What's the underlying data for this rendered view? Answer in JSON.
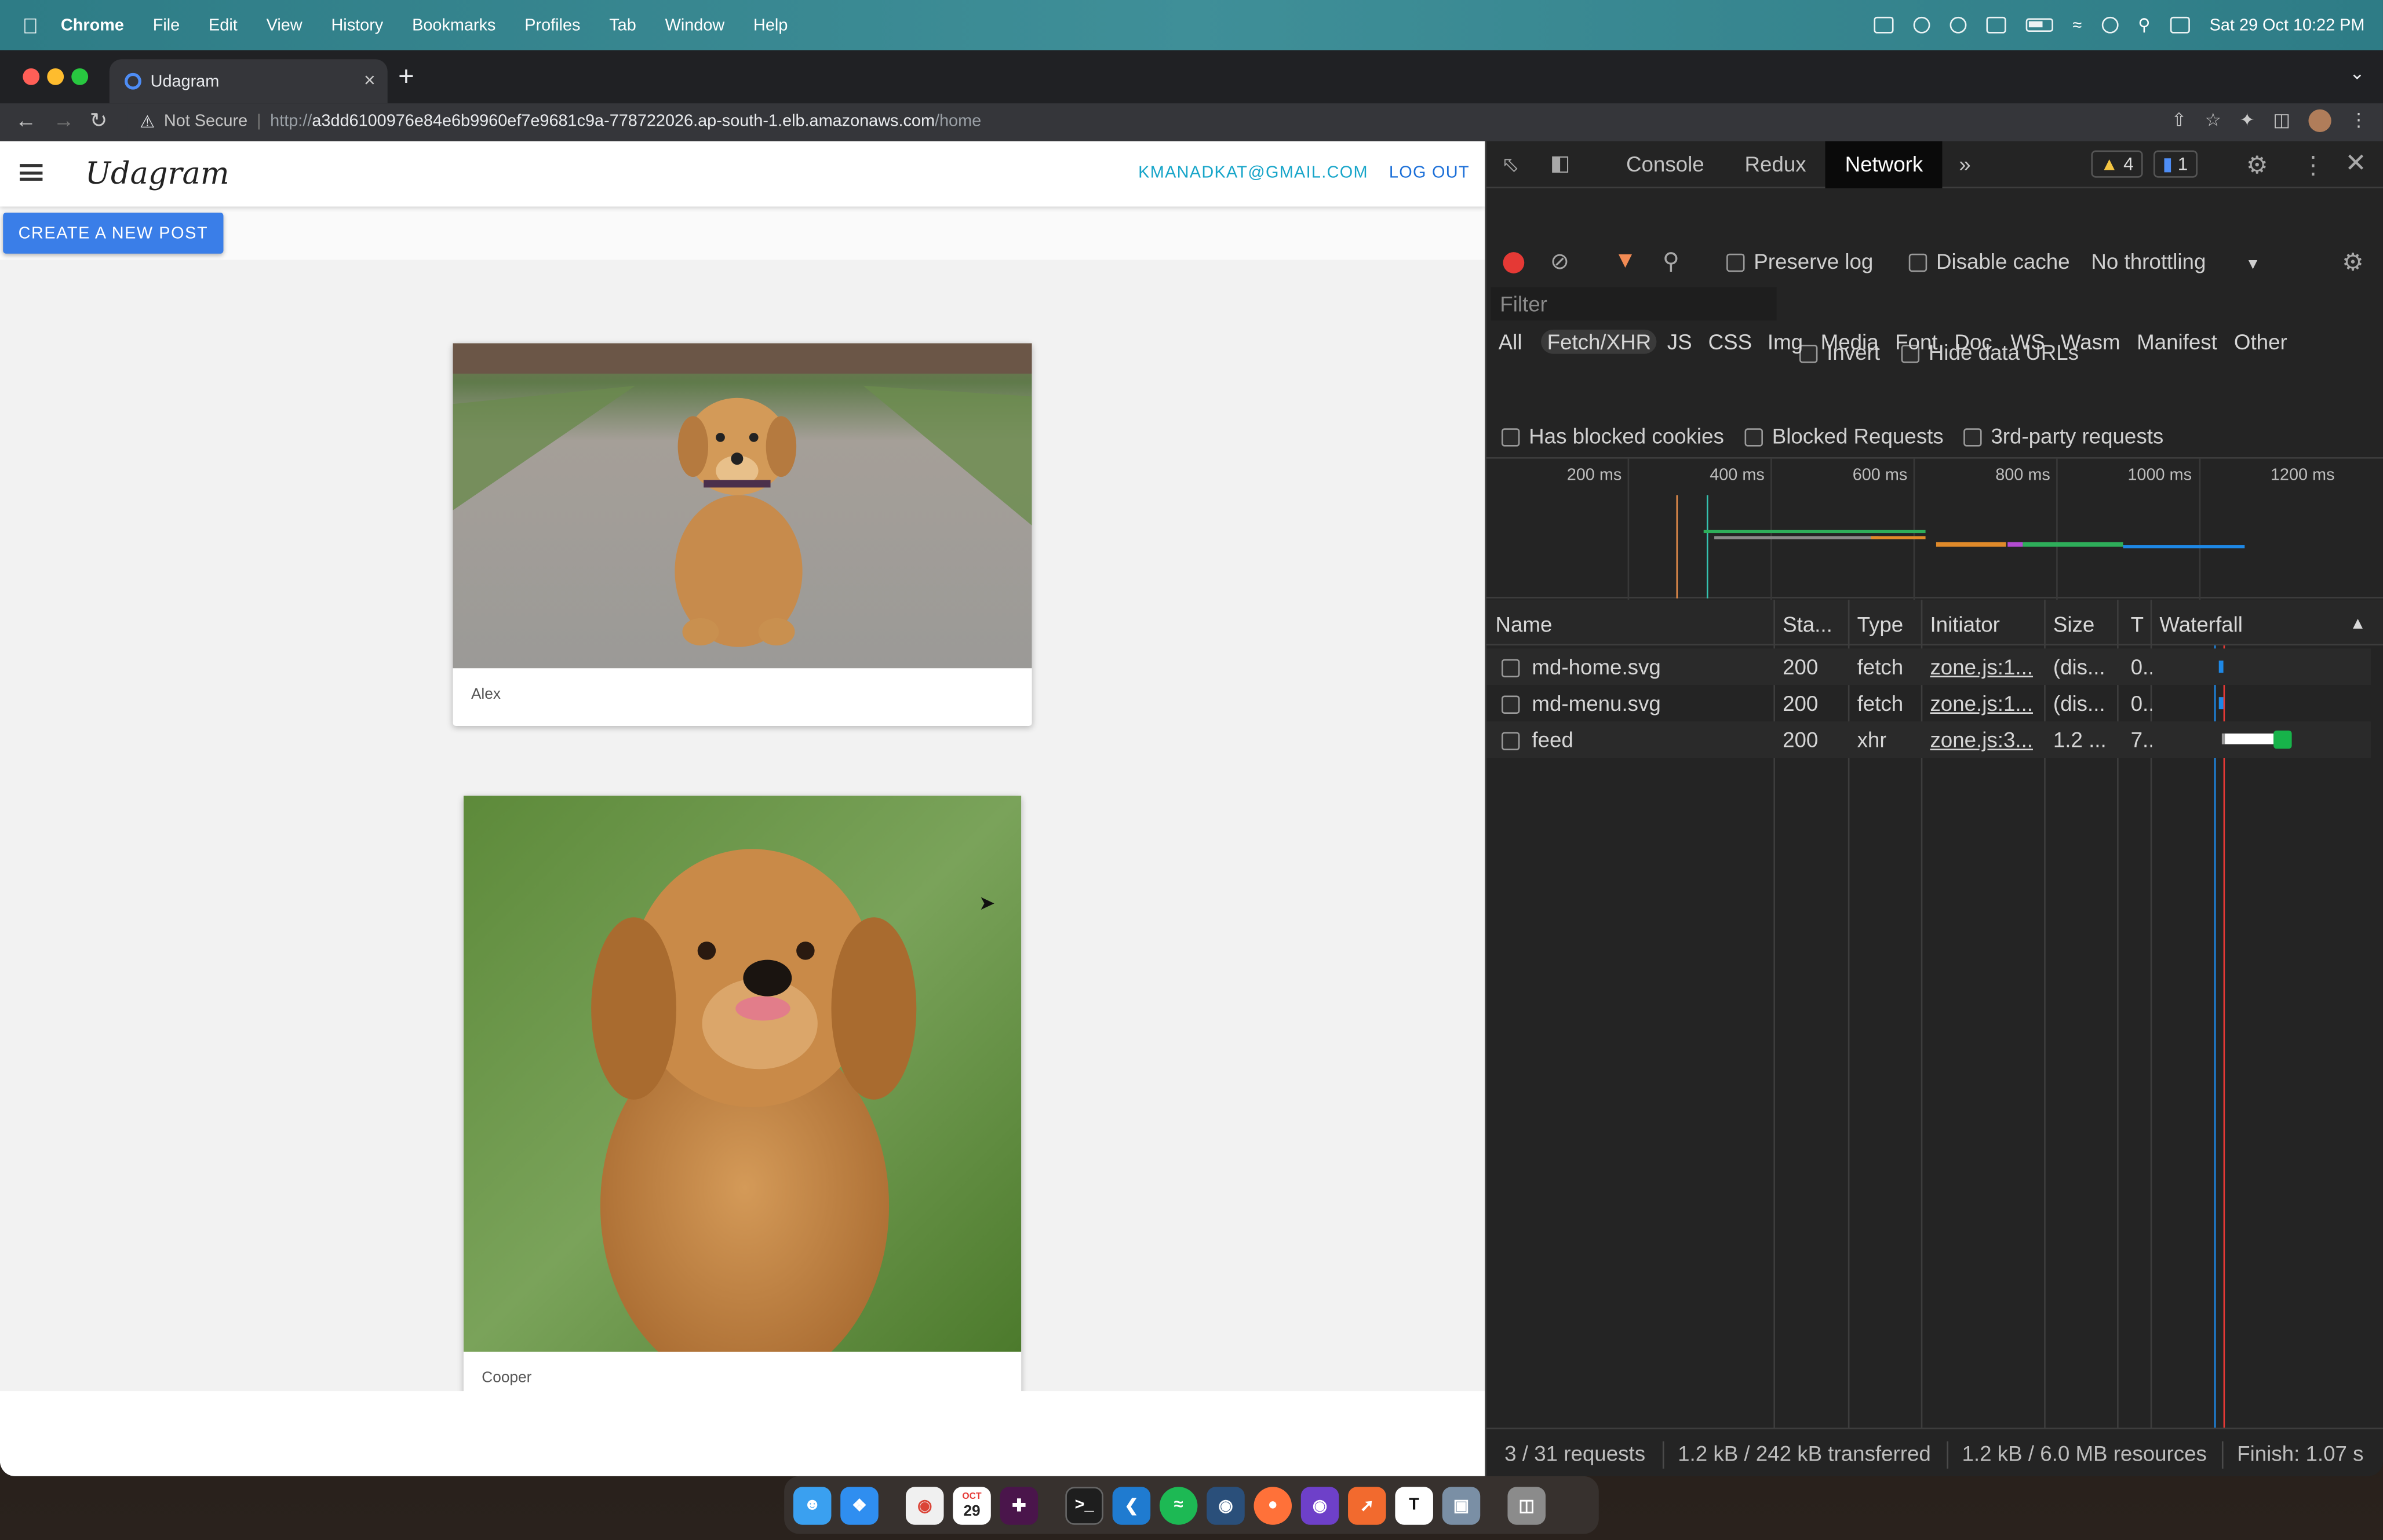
{
  "menubar": {
    "app_name": "Chrome",
    "items": [
      "File",
      "Edit",
      "View",
      "History",
      "Bookmarks",
      "Profiles",
      "Tab",
      "Window",
      "Help"
    ],
    "datetime": "Sat 29 Oct  10:22 PM"
  },
  "browser": {
    "tab_title": "Udagram",
    "tab_close": "×",
    "new_tab": "+",
    "address_warning": "Not Secure",
    "address_scheme": "http://",
    "address_host": "a3dd6100976e84e6b9960ef7e9681c9a-778722026.ap-south-1.elb.amazonaws.com",
    "address_path": "/home"
  },
  "app": {
    "logo": "Udagram",
    "user_email": "KMANADKAT@GMAIL.COM",
    "logout_label": "LOG OUT",
    "create_post_label": "CREATE A NEW POST",
    "posts": [
      {
        "caption": "Alex"
      },
      {
        "caption": "Cooper"
      }
    ]
  },
  "devtools": {
    "tabs": [
      "Console",
      "Redux",
      "Network"
    ],
    "active_tab": "Network",
    "more_tabs": "»",
    "warnings_count": "4",
    "messages_count": "1",
    "preserve_log": "Preserve log",
    "disable_cache": "Disable cache",
    "throttling": "No throttling",
    "filter_placeholder": "Filter",
    "invert": "Invert",
    "hide_data_urls": "Hide data URLs",
    "type_filters": [
      "All",
      "Fetch/XHR",
      "JS",
      "CSS",
      "Img",
      "Media",
      "Font",
      "Doc",
      "WS",
      "Wasm",
      "Manifest",
      "Other"
    ],
    "active_type_filter": "Fetch/XHR",
    "has_blocked_cookies": "Has blocked cookies",
    "blocked_requests": "Blocked Requests",
    "third_party": "3rd-party requests",
    "timeline_ticks": [
      "200 ms",
      "400 ms",
      "600 ms",
      "800 ms",
      "1000 ms",
      "1200 ms"
    ],
    "columns": [
      "Name",
      "Sta...",
      "Type",
      "Initiator",
      "Size",
      "T",
      "Waterfall"
    ],
    "requests": [
      {
        "name": "md-home.svg",
        "status": "200",
        "type": "fetch",
        "initiator": "zone.js:1...",
        "size": "(dis...",
        "time": "0.."
      },
      {
        "name": "md-menu.svg",
        "status": "200",
        "type": "fetch",
        "initiator": "zone.js:1...",
        "size": "(dis...",
        "time": "0.."
      },
      {
        "name": "feed",
        "status": "200",
        "type": "xhr",
        "initiator": "zone.js:3...",
        "size": "1.2 ...",
        "time": "7.."
      }
    ],
    "summary": {
      "requests": "3 / 31 requests",
      "transferred": "1.2 kB / 242 kB transferred",
      "resources": "1.2 kB / 6.0 MB resources",
      "finish": "Finish: 1.07 s"
    }
  },
  "colors": {
    "menubar": "#3a8a93",
    "create_button": "#3a7ee8",
    "email_link": "#17a5c9",
    "record_button": "#e53935"
  },
  "dock": {
    "calendar_month": "OCT",
    "calendar_day": "29"
  }
}
